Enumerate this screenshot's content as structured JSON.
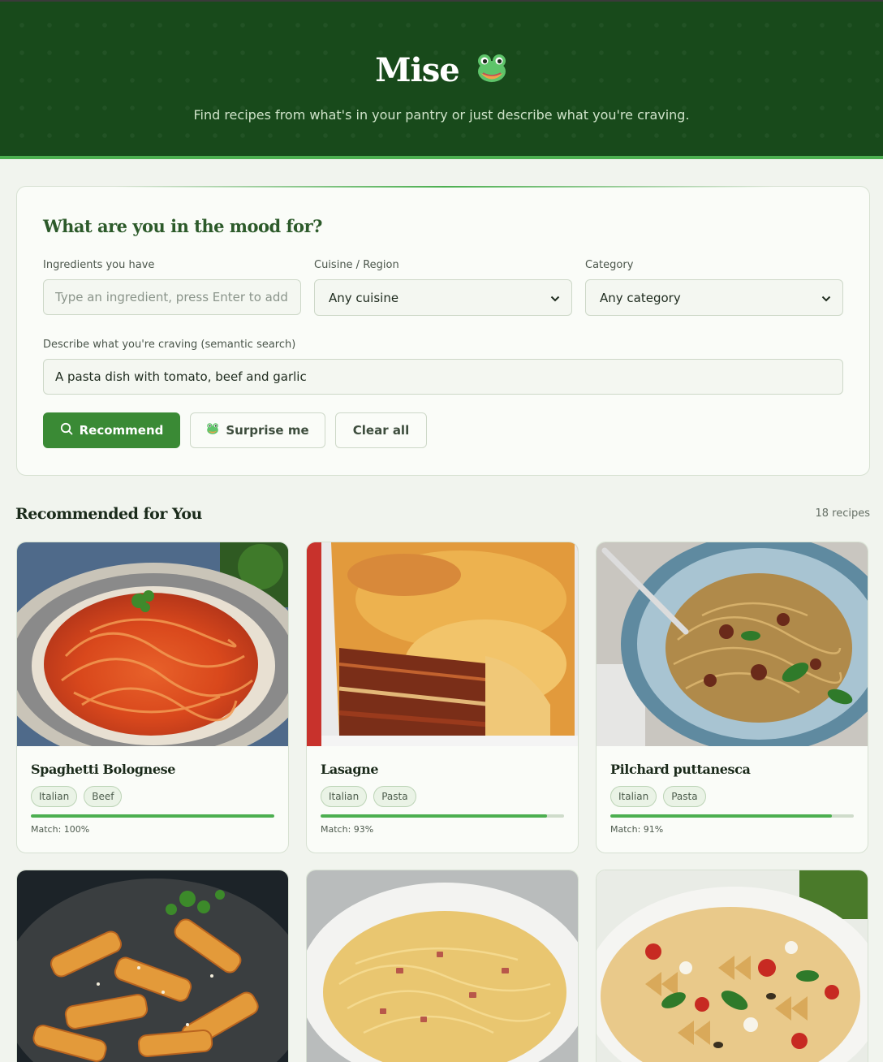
{
  "app": {
    "name": "Mise",
    "logo_icon": "frog-icon",
    "tagline": "Find recipes from what's in your pantry or just describe what you're craving."
  },
  "search": {
    "title": "What are you in the mood for?",
    "ingredients": {
      "label": "Ingredients you have",
      "placeholder": "Type an ingredient, press Enter to add...",
      "value": ""
    },
    "cuisine": {
      "label": "Cuisine / Region",
      "value": "Any cuisine"
    },
    "category": {
      "label": "Category",
      "value": "Any category"
    },
    "craving": {
      "label": "Describe what you're craving (semantic search)",
      "value": "A pasta dish with tomato, beef and garlic"
    },
    "buttons": {
      "recommend": "Recommend",
      "surprise": "Surprise me",
      "clear": "Clear all"
    }
  },
  "results": {
    "title": "Recommended for You",
    "count": "18 recipes",
    "recipes": [
      {
        "title": "Spaghetti Bolognese",
        "tags": [
          "Italian",
          "Beef"
        ],
        "match_label": "Match: 100%",
        "match": 1.0,
        "image": "spaghetti-bolognese-photo"
      },
      {
        "title": "Lasagne",
        "tags": [
          "Italian",
          "Pasta"
        ],
        "match_label": "Match: 93%",
        "match": 0.93,
        "image": "lasagne-photo"
      },
      {
        "title": "Pilchard puttanesca",
        "tags": [
          "Italian",
          "Pasta"
        ],
        "match_label": "Match: 91%",
        "match": 0.91,
        "image": "pilchard-puttanesca-photo"
      },
      {
        "image": "penne-pasta-photo"
      },
      {
        "image": "carbonara-pasta-photo"
      },
      {
        "image": "farfalle-salad-photo"
      }
    ]
  },
  "colors": {
    "header_bg": "#184a1b",
    "accent": "#4caf50",
    "primary_button": "#3a8a35",
    "heading": "#2c5a2a"
  }
}
